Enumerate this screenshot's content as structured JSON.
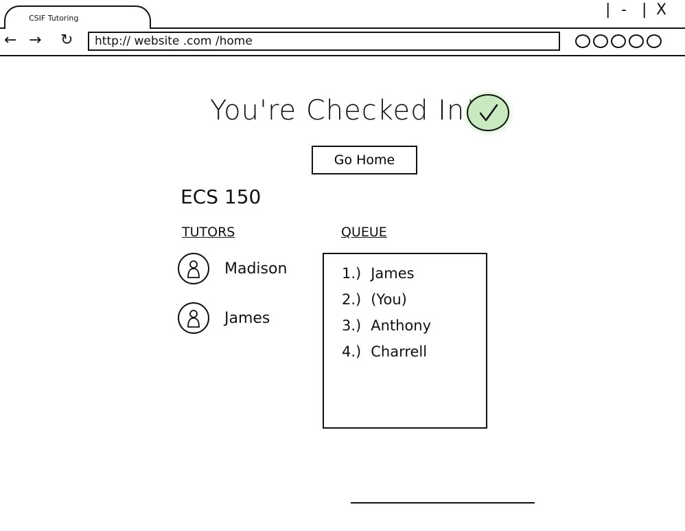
{
  "browser": {
    "tab_title": "CSIF Tutoring",
    "url": "http:// website .com  /home",
    "window_controls": [
      "|",
      "-",
      "|",
      "X"
    ],
    "nav": {
      "back": "←",
      "forward": "→",
      "refresh": "↻"
    },
    "menu_dots_count": 5
  },
  "page": {
    "heading": "You're Checked In!",
    "status_icon": "check-icon",
    "status_color": "#c9eac0",
    "go_home_label": "Go Home",
    "course": "ECS 150",
    "tutors_label": "TUTORS",
    "queue_label": "QUEUE",
    "tutors": [
      {
        "name": "Madison"
      },
      {
        "name": "James"
      }
    ],
    "queue": [
      {
        "num": "1.)",
        "name": "James"
      },
      {
        "num": "2.)",
        "name": "(You)"
      },
      {
        "num": "3.)",
        "name": "Anthony"
      },
      {
        "num": "4.)",
        "name": "Charrell"
      }
    ]
  }
}
